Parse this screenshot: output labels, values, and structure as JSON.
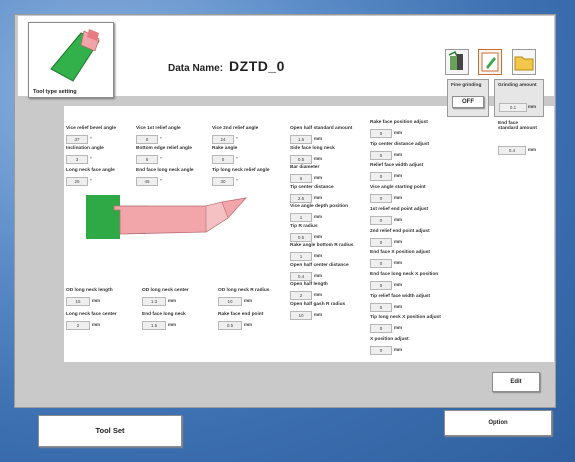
{
  "app": {
    "data_name_label": "Data Name:",
    "data_name_value": "DZTD_0"
  },
  "toolcard": {
    "label": "Tool type setting"
  },
  "toolbar": {
    "icons": [
      "machine-icon",
      "edit-icon",
      "folder-icon"
    ]
  },
  "fine_grinding": {
    "label": "Fine grinding",
    "value": "OFF"
  },
  "grinding_amount": {
    "label": "Grinding amount",
    "value": "0.1",
    "unit": "mm"
  },
  "end_face_standard": {
    "label": "End face standard amount",
    "value": "0.4",
    "unit": "mm"
  },
  "angles": [
    {
      "label": "Vice relief bevel angle",
      "value": "37",
      "unit": "°"
    },
    {
      "label": "Vice 1st relief angle",
      "value": "0",
      "unit": "°"
    },
    {
      "label": "Vice 2nd relief angle",
      "value": "24",
      "unit": "°"
    },
    {
      "label": "Inclination angle",
      "value": "3",
      "unit": "°"
    },
    {
      "label": "Bottom edge relief angle",
      "value": "6",
      "unit": "°"
    },
    {
      "label": "Rake angle",
      "value": "0",
      "unit": "°"
    },
    {
      "label": "Long neck face angle",
      "value": "25",
      "unit": "°"
    },
    {
      "label": "End face long neck angle",
      "value": "45",
      "unit": "°"
    },
    {
      "label": "Tip long neck relief angle",
      "value": "30",
      "unit": "°"
    }
  ],
  "lower": [
    {
      "label": "OD long neck length",
      "value": "15",
      "unit": "mm"
    },
    {
      "label": "OD long neck center",
      "value": "1.3",
      "unit": "mm"
    },
    {
      "label": "OD long neck R radius",
      "value": "10",
      "unit": "mm"
    },
    {
      "label": "Long neck face center",
      "value": "2",
      "unit": "mm"
    },
    {
      "label": "End face long neck",
      "value": "1.5",
      "unit": "mm"
    },
    {
      "label": "Rake face end point",
      "value": "0.5",
      "unit": "mm"
    }
  ],
  "mid": [
    {
      "label": "Open half standard amount",
      "value": "1.5",
      "unit": "mm"
    },
    {
      "label": "Side face long neck",
      "value": "0.5",
      "unit": "mm"
    },
    {
      "label": "Bar diameter",
      "value": "6",
      "unit": "mm"
    },
    {
      "label": "Tip center distance",
      "value": "2.5",
      "unit": "mm"
    },
    {
      "label": "Vice angle depth position",
      "value": "1",
      "unit": "mm"
    },
    {
      "label": "Tip R radius",
      "value": "0.5",
      "unit": "mm"
    },
    {
      "label": "Rake angle bottom R radius",
      "value": "1",
      "unit": "mm"
    },
    {
      "label": "Open half center distance",
      "value": "0.4",
      "unit": "mm"
    },
    {
      "label": "Open half length",
      "value": "2",
      "unit": "mm"
    },
    {
      "label": "Open half gash R radius",
      "value": "10",
      "unit": "mm"
    }
  ],
  "right": [
    {
      "label": "Rake face position adjust",
      "value": "0",
      "unit": "mm"
    },
    {
      "label": "Tip center distance adjust",
      "value": "0",
      "unit": "mm"
    },
    {
      "label": "Relief face width adjust",
      "value": "0",
      "unit": "mm"
    },
    {
      "label": "Vice angle starting point",
      "value": "0",
      "unit": "mm"
    },
    {
      "label": "1st relief end point adjust",
      "value": "0",
      "unit": "mm"
    },
    {
      "label": "2nd relief end point adjust",
      "value": "0",
      "unit": "mm"
    },
    {
      "label": "End face X position adjust",
      "value": "0",
      "unit": "mm"
    },
    {
      "label": "End face long neck X position",
      "value": "0",
      "unit": "mm"
    },
    {
      "label": "Tip relief face width adjust",
      "value": "0",
      "unit": "mm"
    },
    {
      "label": "Tip long neck X position adjust",
      "value": "0",
      "unit": "mm"
    },
    {
      "label": "X position adjust",
      "value": "0",
      "unit": "mm"
    }
  ],
  "buttons": {
    "edit": "Edit",
    "tool_set": "Tool Set",
    "option": "Option"
  }
}
